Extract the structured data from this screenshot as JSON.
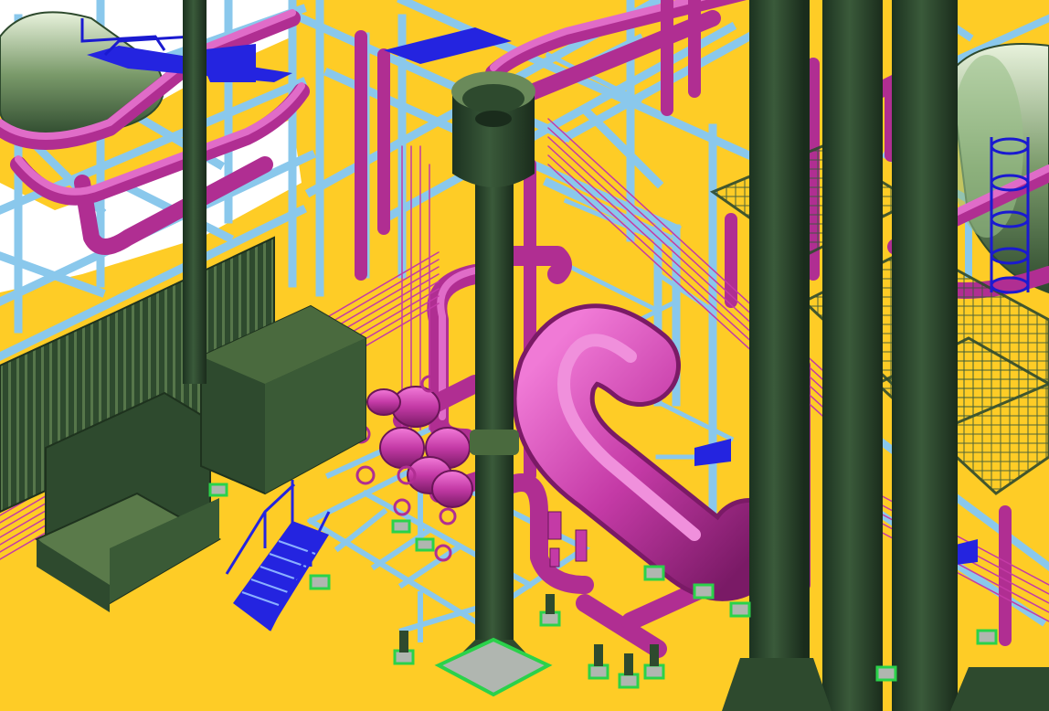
{
  "viewport": {
    "kind": "3d-plant-model-render",
    "visible_text": []
  },
  "palette": {
    "ground": "#fecc26",
    "steel_structure": "#8ac8ec",
    "steel_structure_dark": "#4a8ab8",
    "piping_magenta": "#d640b4",
    "piping_magenta_dark": "#8a1e74",
    "equipment_green": "#2e4a2e",
    "equipment_green_light": "#6a8a5a",
    "stair_blue": "#2424e0",
    "ladder_blue": "#1a1ad0",
    "foundation_green": "#2ad24a",
    "foundation_grey": "#b0b6b0",
    "bore_white": "#ffffff"
  },
  "objects": [
    "steel-structure",
    "process-piping",
    "vertical-stack",
    "vertical-columns",
    "horizontal-vessels",
    "heat-exchanger-tanks",
    "access-stair",
    "cage-ladder",
    "grating-platforms",
    "control-valves",
    "equipment-foundations"
  ]
}
